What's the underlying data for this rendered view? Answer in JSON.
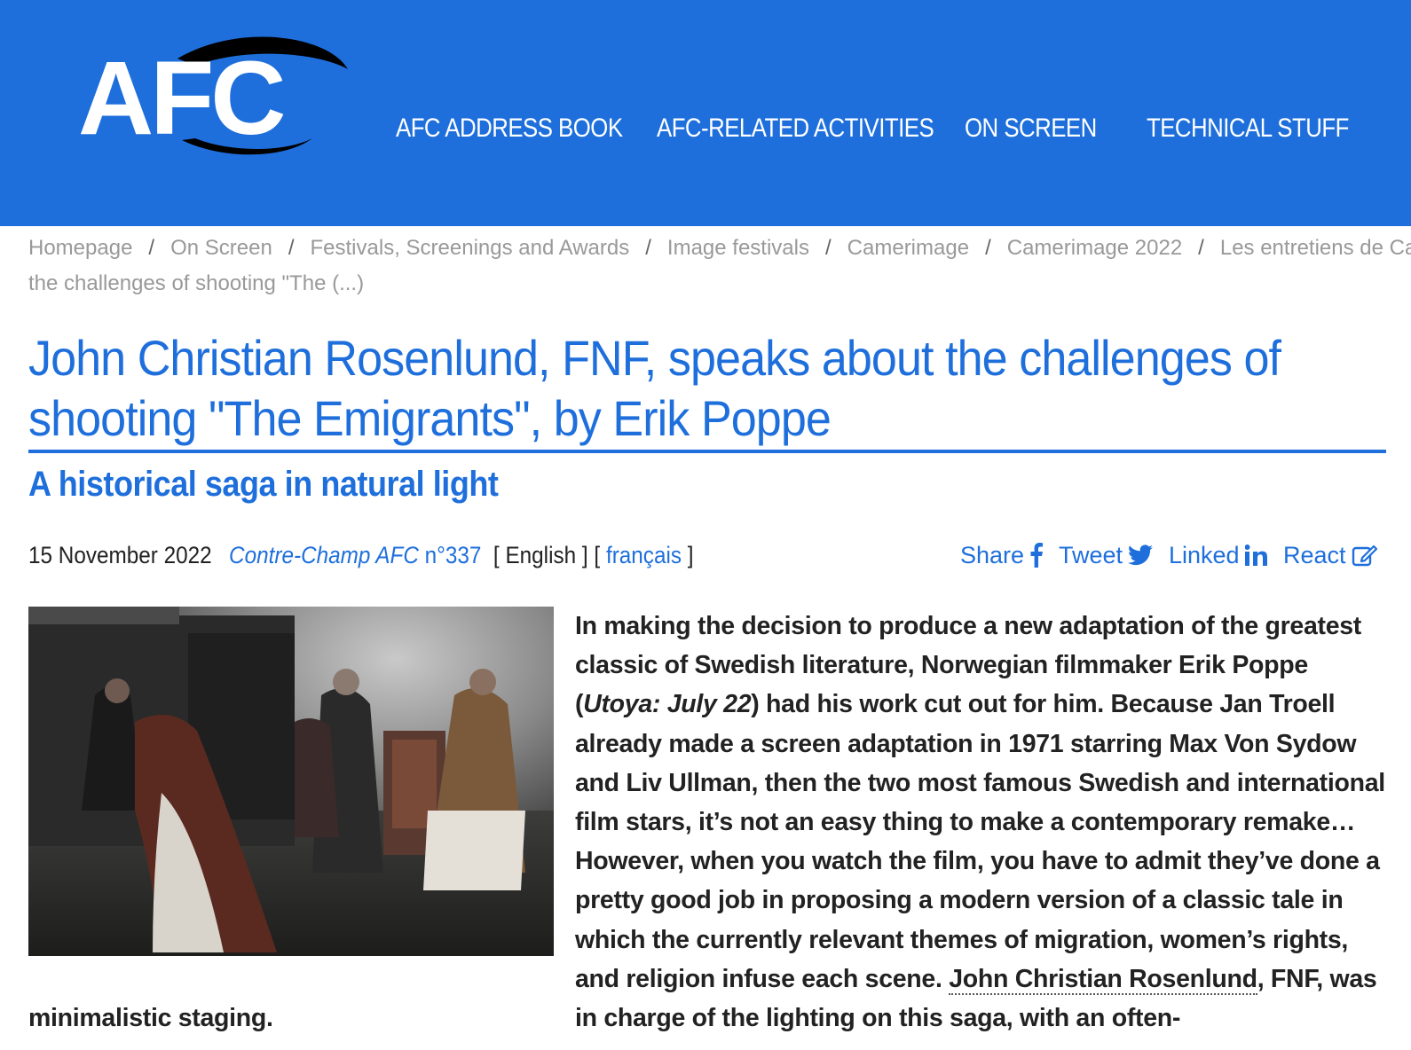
{
  "header": {
    "logo_text": "AFC",
    "nav": [
      {
        "label": "AFC ADDRESS BOOK"
      },
      {
        "label": "AFC-RELATED ACTIVITIES"
      },
      {
        "label": "ON SCREEN"
      },
      {
        "label": "TECHNICAL STUFF"
      }
    ]
  },
  "breadcrumb": {
    "items": [
      "Homepage",
      "On Screen",
      "Festivals, Screenings and Awards",
      "Image festivals",
      "Camerimage",
      "Camerimage 2022",
      "Les entretiens de Camerimage"
    ],
    "separator": "/",
    "current": "the challenges of shooting \"The (...)"
  },
  "article": {
    "title": "John Christian Rosenlund, FNF, speaks about the challenges of shooting \"The Emigrants\", by Erik Poppe",
    "subtitle": "A historical saga in natural light",
    "date": "15 November 2022",
    "issue_italic": "Contre-Champ AFC",
    "issue_number": " n°337",
    "lang_current": "English",
    "lang_other": "français",
    "body_part1": "In making the decision to produce a new adaptation of the greatest classic of Swedish literature, Norwegian filmmaker Erik Poppe (",
    "body_italic": "Utoya: July 22",
    "body_part2": ") had his work cut out for him. Because Jan Troell already made a screen adaptation in 1971 starring Max Von Sydow and Liv Ullman, then the two most famous Swedish and international film stars, it’s not an easy thing to make a contemporary remake… However, when you watch the film, you have to admit they’ve done a pretty good job in proposing a modern version of a classic tale in which the currently relevant themes of migration, women’s rights, and religion infuse each scene. ",
    "body_link": "John Christian Rosenlund",
    "body_part3": ", FNF, was in charge of the lighting on this saga, with an often-",
    "body_tail": "minimalistic staging."
  },
  "social": {
    "share": "Share",
    "tweet": "Tweet",
    "linked": "Linked",
    "react": "React"
  },
  "colors": {
    "brand_blue": "#1e6fdc",
    "breadcrumb_gray": "#999999",
    "text": "#222222"
  }
}
